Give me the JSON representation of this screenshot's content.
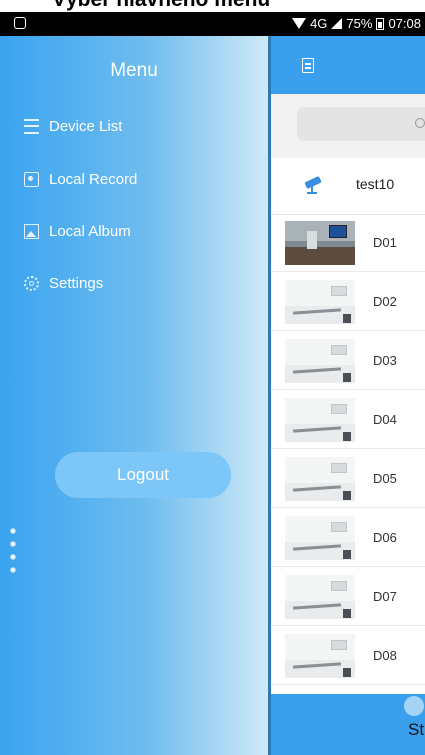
{
  "caption": {
    "text": "Výber hlavného menu"
  },
  "status_bar": {
    "network": "4G",
    "battery": "75%",
    "time": "07:08"
  },
  "drawer": {
    "title": "Menu",
    "items": [
      {
        "label": "Device List",
        "icon": "list-icon"
      },
      {
        "label": "Local Record",
        "icon": "record-icon"
      },
      {
        "label": "Local Album",
        "icon": "album-icon"
      },
      {
        "label": "Settings",
        "icon": "gear-icon"
      }
    ],
    "logout_label": "Logout"
  },
  "main": {
    "device": {
      "name": "test10",
      "icon": "camera-icon"
    },
    "channels": [
      {
        "label": "D01"
      },
      {
        "label": "D02"
      },
      {
        "label": "D03"
      },
      {
        "label": "D04"
      },
      {
        "label": "D05"
      },
      {
        "label": "D06"
      },
      {
        "label": "D07"
      },
      {
        "label": "D08"
      }
    ],
    "bottom_label": "St"
  },
  "colors": {
    "accent": "#3aa0ee",
    "drawer_start": "#3aa3ef",
    "drawer_end": "#cfe9f7"
  }
}
